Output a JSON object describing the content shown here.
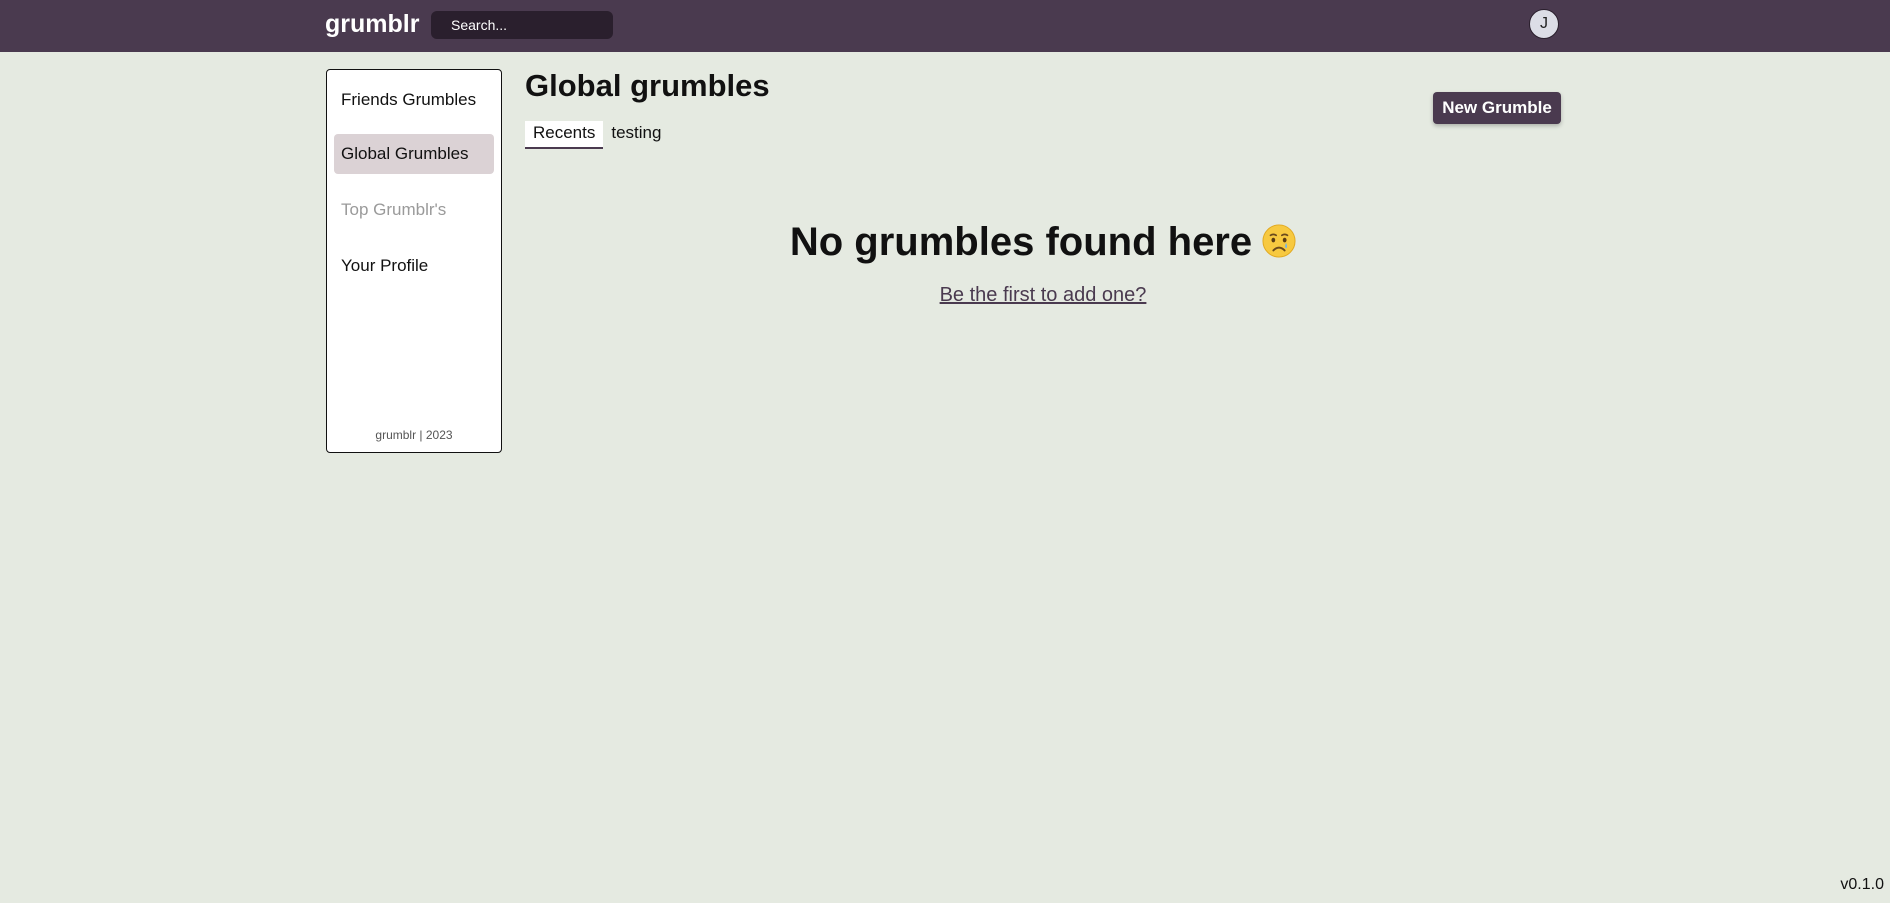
{
  "header": {
    "logo": "grumblr",
    "search_placeholder": "Search...",
    "avatar_initial": "J"
  },
  "sidebar": {
    "items": [
      {
        "label": "Friends Grumbles",
        "state": "normal"
      },
      {
        "label": "Global Grumbles",
        "state": "active"
      },
      {
        "label": "Top Grumblr's",
        "state": "disabled"
      },
      {
        "label": "Your Profile",
        "state": "normal"
      }
    ],
    "footer": "grumblr | 2023"
  },
  "main": {
    "title": "Global grumbles",
    "tabs": [
      {
        "label": "Recents",
        "active": true
      },
      {
        "label": "testing",
        "active": false
      }
    ],
    "new_button_label": "New Grumble",
    "empty_title": "No grumbles found here",
    "empty_emoji": "crying-face-icon",
    "empty_link": "Be the first to add one?"
  },
  "version": "v0.1.0",
  "colors": {
    "header_bg": "#4a3a4f",
    "page_bg": "#e5eae1",
    "active_item_bg": "#dbd2d5",
    "search_bg": "#2a1f2d"
  }
}
